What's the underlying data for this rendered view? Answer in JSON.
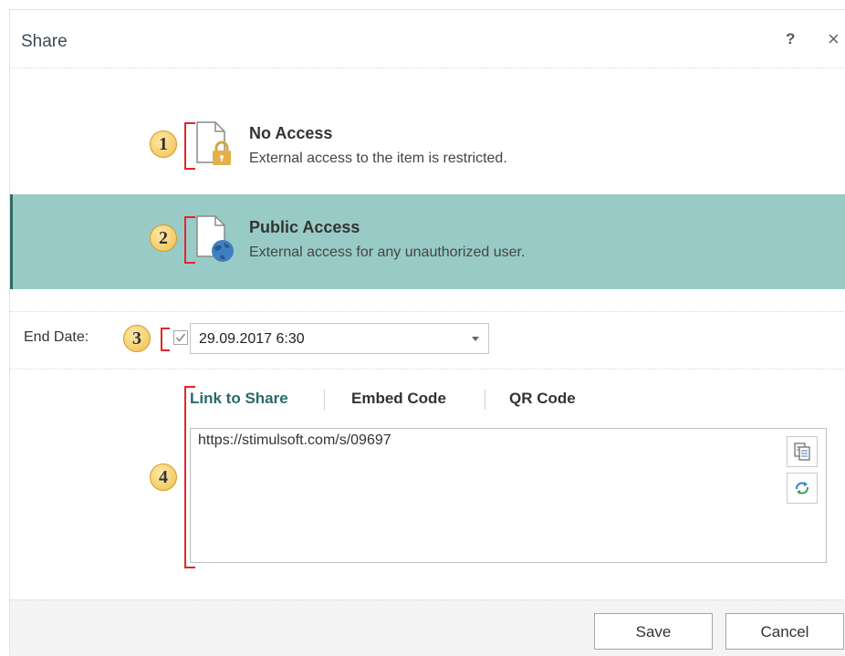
{
  "dialog": {
    "title": "Share",
    "help_glyph": "?",
    "close_glyph": "×"
  },
  "options": [
    {
      "title": "No Access",
      "description": "External access to the item is restricted.",
      "icon": "document-lock-icon",
      "selected": false
    },
    {
      "title": "Public Access",
      "description": "External access for any unauthorized user.",
      "icon": "document-globe-icon",
      "selected": true
    }
  ],
  "end_date": {
    "label": "End Date:",
    "checked": true,
    "value": "29.09.2017 6:30"
  },
  "tabs": [
    {
      "label": "Link to Share",
      "active": true
    },
    {
      "label": "Embed Code",
      "active": false
    },
    {
      "label": "QR Code",
      "active": false
    }
  ],
  "link": {
    "url": "https://stimulsoft.com/s/09697"
  },
  "callouts": [
    "1",
    "2",
    "3",
    "4"
  ],
  "footer": {
    "save_label": "Save",
    "cancel_label": "Cancel"
  },
  "colors": {
    "selected_bg": "#99cbc6",
    "selected_bar": "#2d6b65",
    "active_tab": "#2a6a6a",
    "callout_bracket": "#e0262b",
    "callout_badge": "#f1bf4d"
  }
}
